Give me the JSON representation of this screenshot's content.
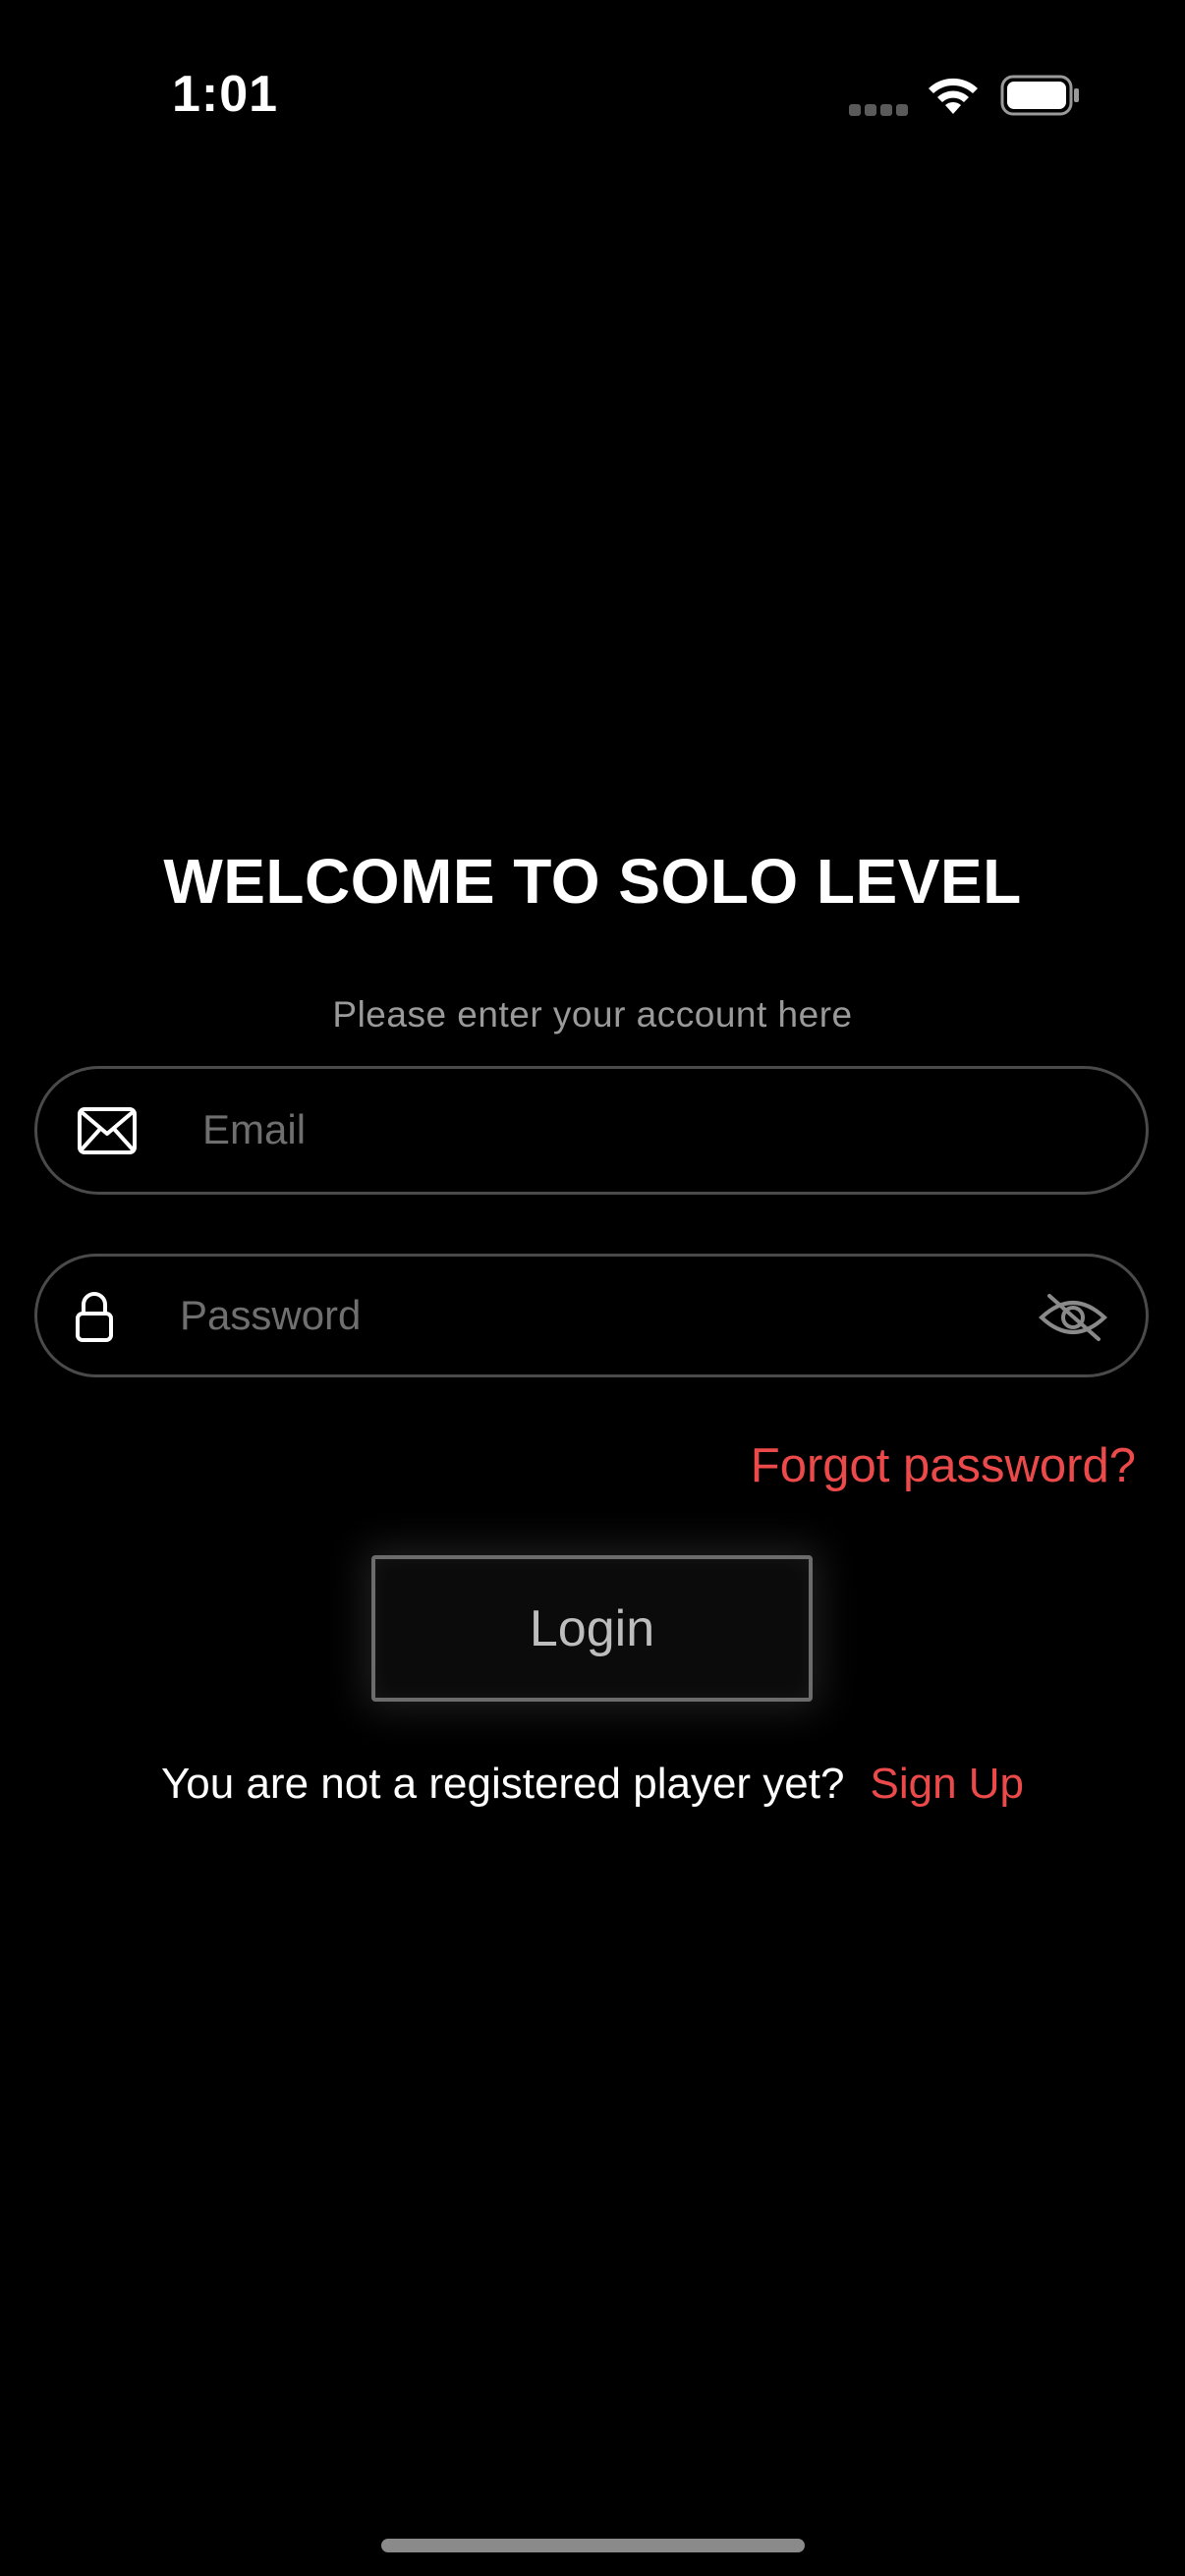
{
  "status_bar": {
    "time": "1:01",
    "signal_icon": "cellular-signal-icon",
    "wifi_icon": "wifi-icon",
    "battery_icon": "battery-icon"
  },
  "welcome": {
    "title": "WELCOME TO SOLO LEVEL",
    "subtitle": "Please enter your account here"
  },
  "form": {
    "email": {
      "icon": "envelope-icon",
      "placeholder": "Email",
      "value": ""
    },
    "password": {
      "icon": "lock-icon",
      "placeholder": "Password",
      "value": "",
      "visibility_icon": "eye-slash-icon"
    },
    "forgot_password_label": "Forgot password?",
    "login_label": "Login"
  },
  "signup": {
    "prompt": "You are not a registered player yet?",
    "link_label": "Sign Up"
  },
  "colors": {
    "background": "#000000",
    "accent_red": "#ec4a4a",
    "field_border": "#4a4a4a",
    "placeholder": "#6f6f6f",
    "subtitle": "#9a9a9a"
  }
}
